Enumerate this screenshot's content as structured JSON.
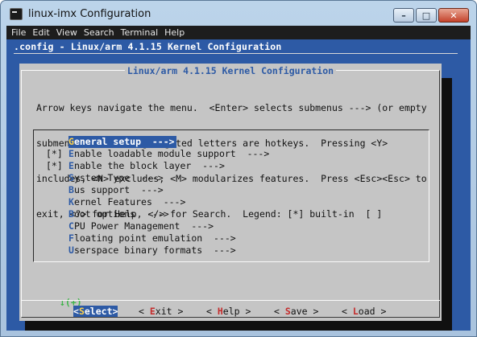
{
  "window": {
    "title": "linux-imx Configuration",
    "controls": {
      "minimize": "–",
      "maximize": "□",
      "close": "✕"
    }
  },
  "menubar": [
    "File",
    "Edit",
    "View",
    "Search",
    "Terminal",
    "Help"
  ],
  "terminal": {
    "header": ".config - Linux/arm 4.1.15 Kernel Configuration",
    "dialog_title": "Linux/arm 4.1.15 Kernel Configuration",
    "help_lines": [
      "Arrow keys navigate the menu.  <Enter> selects submenus ---> (or empty",
      "submenus ----).  Highlighted letters are hotkeys.  Pressing <Y>",
      "includes, <N> excludes, <M> modularizes features.  Press <Esc><Esc> to",
      "exit, <?> for Help, </> for Search.  Legend: [*] built-in  [ ]"
    ],
    "menu_items": [
      {
        "prefix": "   ",
        "hotkey": "G",
        "rest": "eneral setup  --->",
        "selected": true
      },
      {
        "prefix": "[*]",
        "hotkey": "E",
        "rest": "nable loadable module support  --->",
        "selected": false
      },
      {
        "prefix": "[*]",
        "hotkey": "E",
        "rest": "nable the block layer  --->",
        "selected": false
      },
      {
        "prefix": "   ",
        "hotkey": "S",
        "rest": "ystem Type  --->",
        "selected": false
      },
      {
        "prefix": "   ",
        "hotkey": "B",
        "rest": "us support  --->",
        "selected": false
      },
      {
        "prefix": "   ",
        "hotkey": "K",
        "rest": "ernel Features  --->",
        "selected": false
      },
      {
        "prefix": "   ",
        "hotkey": "B",
        "rest": "oot options  --->",
        "selected": false
      },
      {
        "prefix": "   ",
        "hotkey": "C",
        "rest": "PU Power Management  --->",
        "selected": false
      },
      {
        "prefix": "   ",
        "hotkey": "F",
        "rest": "loating point emulation  --->",
        "selected": false
      },
      {
        "prefix": "   ",
        "hotkey": "U",
        "rest": "serspace binary formats  --->",
        "selected": false
      }
    ],
    "scroll_indicator": "↓(+)",
    "buttons": [
      {
        "pre": "<",
        "hotkey": "S",
        "rest": "elect>",
        "active": true
      },
      {
        "pre": "< ",
        "hotkey": "E",
        "rest": "xit >",
        "active": false
      },
      {
        "pre": "< ",
        "hotkey": "H",
        "rest": "elp >",
        "active": false
      },
      {
        "pre": "< ",
        "hotkey": "S",
        "rest": "ave >",
        "active": false
      },
      {
        "pre": "< ",
        "hotkey": "L",
        "rest": "oad >",
        "active": false
      }
    ]
  },
  "colors": {
    "terminal_bg": "#2d5aa5",
    "dialog_bg": "#c5c5c5",
    "hotkey_blue": "#2d5aa5",
    "hotkey_red": "#c42c2c",
    "scroll_green": "#3fb54a"
  }
}
